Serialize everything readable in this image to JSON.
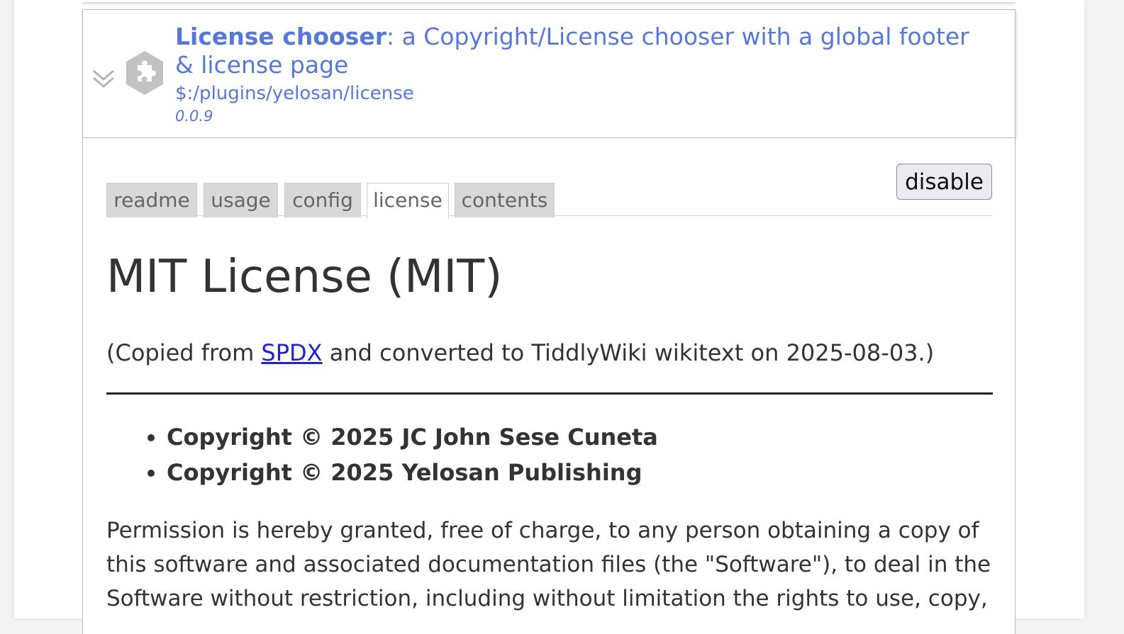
{
  "plugin": {
    "name": "License chooser",
    "description": ": a Copyright/License chooser with a global footer & license page",
    "path": "$:/plugins/yelosan/license",
    "version": "0.0.9",
    "chevron_icon": "double-chevron-down-icon",
    "plugin_icon": "puzzle-piece-icon",
    "accent_color": "#5778d8"
  },
  "toolbar": {
    "disable_label": "disable"
  },
  "tabs": [
    {
      "label": "readme",
      "active": false
    },
    {
      "label": "usage",
      "active": false
    },
    {
      "label": "config",
      "active": false
    },
    {
      "label": "license",
      "active": true
    },
    {
      "label": "contents",
      "active": false
    }
  ],
  "content": {
    "heading": "MIT License (MIT)",
    "copied_prefix": "(Copied from ",
    "copied_link": "SPDX",
    "copied_suffix": " and converted to TiddlyWiki wikitext on 2025-08-03.)",
    "copyrights": [
      "Copyright © 2025 JC John Sese Cuneta",
      "Copyright © 2025 Yelosan Publishing"
    ],
    "permission_text": "Permission is hereby granted, free of charge, to any person obtaining a copy of this software and associated documentation files (the \"Software\"), to deal in the Software without restriction, including without limitation the rights to use, copy,"
  }
}
